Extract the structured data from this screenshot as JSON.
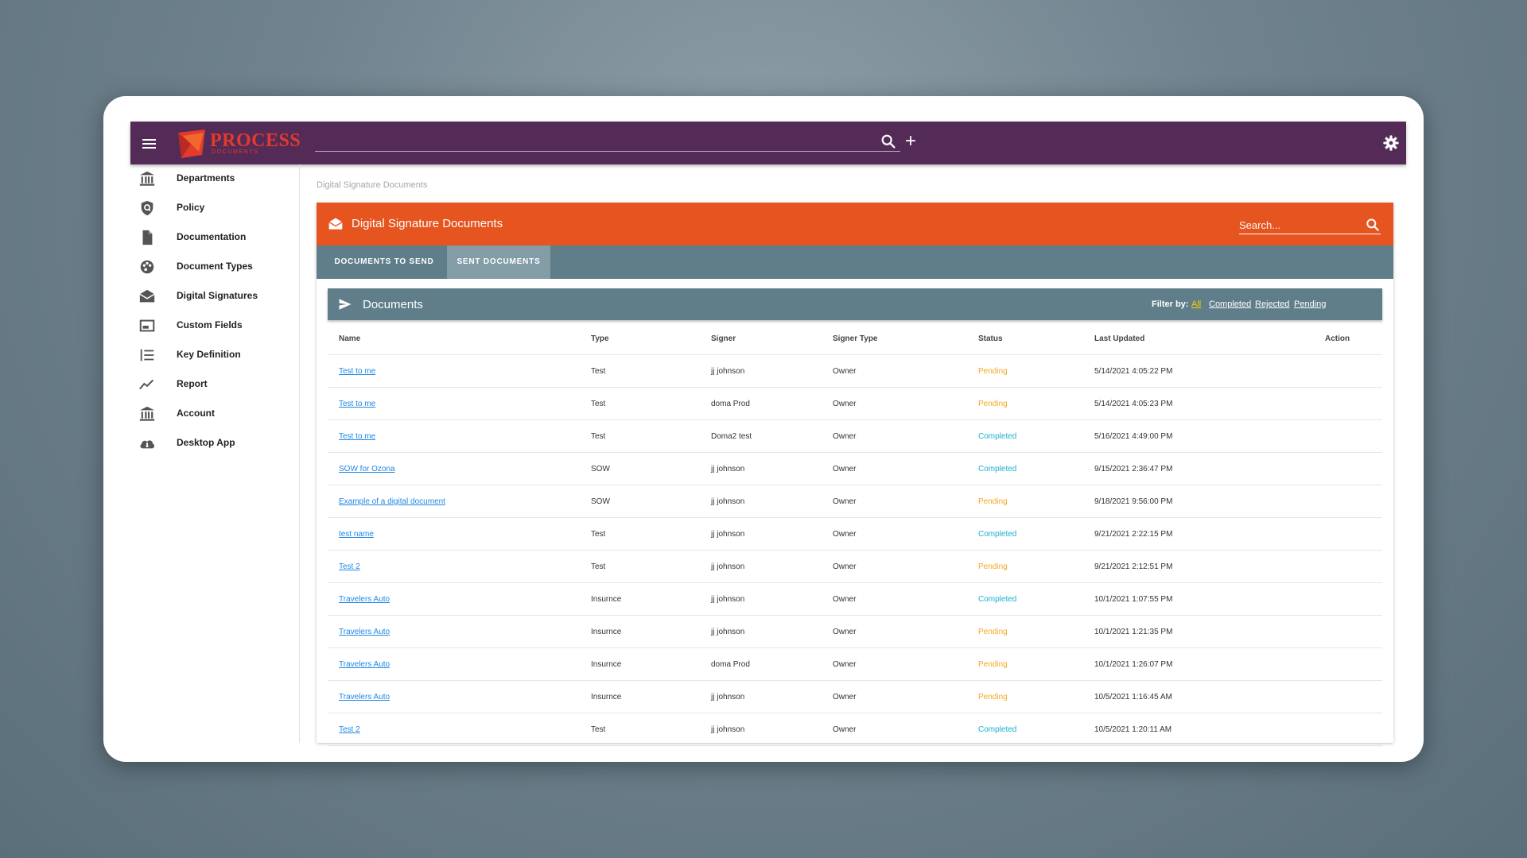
{
  "topbar": {
    "logo_text": "PROCESS",
    "logo_sub": "DOCUMENTS",
    "add_symbol": "+",
    "icons": [
      "hamburger-menu-icon",
      "search-icon",
      "add-icon",
      "gear-icon"
    ],
    "color": "#542a57"
  },
  "sidebar": {
    "items": [
      {
        "label": "Departments",
        "icon": "bank-icon"
      },
      {
        "label": "Policy",
        "icon": "shield-icon"
      },
      {
        "label": "Documentation",
        "icon": "file-icon"
      },
      {
        "label": "Document Types",
        "icon": "palette-icon"
      },
      {
        "label": "Digital Signatures",
        "icon": "envelope-open-icon"
      },
      {
        "label": "Custom Fields",
        "icon": "window-icon"
      },
      {
        "label": "Key Definition",
        "icon": "ordered-list-icon"
      },
      {
        "label": "Report",
        "icon": "trending-icon"
      },
      {
        "label": "Account",
        "icon": "bank-icon"
      },
      {
        "label": "Desktop App",
        "icon": "cloud-download-icon"
      }
    ]
  },
  "breadcrumb": "Digital Signature Documents",
  "card": {
    "title": "Digital Signature Documents",
    "search_placeholder": "Search...",
    "color": "#e6541f",
    "tabs": [
      {
        "label": "Documents to send",
        "active": false
      },
      {
        "label": "Sent documents",
        "active": true
      }
    ]
  },
  "documents": {
    "title": "Documents",
    "filter_label": "Filter by:",
    "filters": [
      "All",
      "Completed",
      "Rejected",
      "Pending"
    ],
    "active_filter": "All",
    "columns": [
      "Name",
      "Type",
      "Signer",
      "Signer Type",
      "Status",
      "Last Updated",
      "Action"
    ],
    "status_colors": {
      "Pending": "#f5a623",
      "Completed": "#1ab0d1"
    },
    "rows": [
      {
        "name": "Test to me",
        "type": "Test",
        "signer": "jj johnson",
        "signer_type": "Owner",
        "status": "Pending",
        "updated": "5/14/2021 4:05:22 PM"
      },
      {
        "name": "Test to me",
        "type": "Test",
        "signer": "doma Prod",
        "signer_type": "Owner",
        "status": "Pending",
        "updated": "5/14/2021 4:05:23 PM"
      },
      {
        "name": "Test to me",
        "type": "Test",
        "signer": "Doma2 test",
        "signer_type": "Owner",
        "status": "Completed",
        "updated": "5/16/2021 4:49:00 PM"
      },
      {
        "name": "SOW for Ozona",
        "type": "SOW",
        "signer": "jj johnson",
        "signer_type": "Owner",
        "status": "Completed",
        "updated": "9/15/2021 2:36:47 PM"
      },
      {
        "name": "Example of a digital document",
        "type": "SOW",
        "signer": "jj johnson",
        "signer_type": "Owner",
        "status": "Pending",
        "updated": "9/18/2021 9:56:00 PM"
      },
      {
        "name": "test name",
        "type": "Test",
        "signer": "jj johnson",
        "signer_type": "Owner",
        "status": "Completed",
        "updated": "9/21/2021 2:22:15 PM"
      },
      {
        "name": "Test 2",
        "type": "Test",
        "signer": "jj johnson",
        "signer_type": "Owner",
        "status": "Pending",
        "updated": "9/21/2021 2:12:51 PM"
      },
      {
        "name": "Travelers Auto",
        "type": "Insurnce",
        "signer": "jj johnson",
        "signer_type": "Owner",
        "status": "Completed",
        "updated": "10/1/2021 1:07:55 PM"
      },
      {
        "name": "Travelers Auto",
        "type": "Insurnce",
        "signer": "jj johnson",
        "signer_type": "Owner",
        "status": "Pending",
        "updated": "10/1/2021 1:21:35 PM"
      },
      {
        "name": "Travelers Auto",
        "type": "Insurnce",
        "signer": "doma Prod",
        "signer_type": "Owner",
        "status": "Pending",
        "updated": "10/1/2021 1:26:07 PM"
      },
      {
        "name": "Travelers Auto",
        "type": "Insurnce",
        "signer": "jj johnson",
        "signer_type": "Owner",
        "status": "Pending",
        "updated": "10/5/2021 1:16:45 AM"
      },
      {
        "name": "Test 2",
        "type": "Test",
        "signer": "jj johnson",
        "signer_type": "Owner",
        "status": "Completed",
        "updated": "10/5/2021 1:20:11 AM"
      }
    ]
  }
}
